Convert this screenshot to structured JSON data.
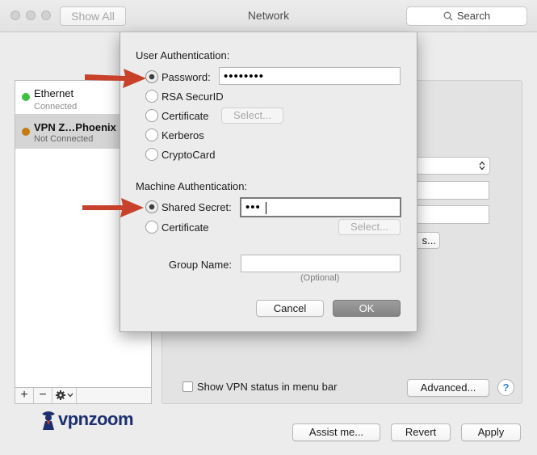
{
  "window": {
    "title": "Network",
    "show_all": "Show All",
    "search_label": "Search"
  },
  "services": [
    {
      "name": "Ethernet",
      "status": "Connected",
      "color": "#3fbf3f"
    },
    {
      "name": "VPN Z…Phoenix",
      "status": "Not Connected",
      "color": "#c77a0d"
    }
  ],
  "list_tools": {
    "add": "+",
    "remove": "−"
  },
  "sheet": {
    "user_auth_title": "User Authentication:",
    "user_options": [
      {
        "label": "Password:",
        "selected": true
      },
      {
        "label": "RSA SecurID",
        "selected": false
      },
      {
        "label": "Certificate",
        "selected": false
      },
      {
        "label": "Kerberos",
        "selected": false
      },
      {
        "label": "CryptoCard",
        "selected": false
      }
    ],
    "password_value": "••••••••",
    "select_label": "Select...",
    "machine_auth_title": "Machine Authentication:",
    "machine_options": [
      {
        "label": "Shared Secret:",
        "selected": true
      },
      {
        "label": "Certificate",
        "selected": false
      }
    ],
    "shared_secret_value": "•••",
    "group_name_label": "Group Name:",
    "group_name_value": "",
    "optional_hint": "(Optional)",
    "cancel_label": "Cancel",
    "ok_label": "OK"
  },
  "panel": {
    "show_vpn_status_label": "Show VPN status in menu bar",
    "advanced_label": "Advanced...",
    "partial_button_label": "s...",
    "help_label": "?"
  },
  "footer": {
    "assist_label": "Assist me...",
    "revert_label": "Revert",
    "apply_label": "Apply"
  },
  "logo": {
    "text": "vpnzoom"
  },
  "colors": {
    "arrow": "#c8412b",
    "ok_button": "#8e8e8e",
    "logo_blue": "#1d2f6e"
  }
}
